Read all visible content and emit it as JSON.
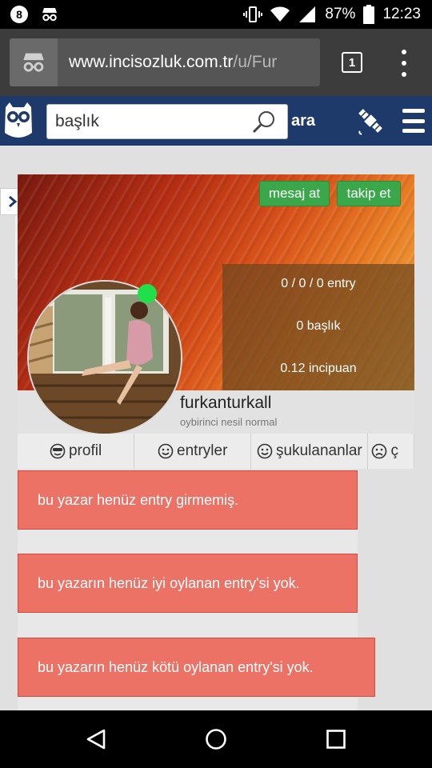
{
  "status_bar": {
    "battery": "87%",
    "time": "12:23"
  },
  "browser": {
    "url_main": "www.incisozluk.com.tr",
    "url_path": "/u/Fur",
    "tab_count": "1"
  },
  "site_nav": {
    "search_placeholder": "başlık",
    "search_button": "ara"
  },
  "profile": {
    "buttons": {
      "message": "mesaj at",
      "follow": "takip et"
    },
    "stats": {
      "entries": "0 / 0 / 0 entry",
      "topics": "0 başlık",
      "points": "0.12 incipuan"
    },
    "username": "furkanturkall",
    "user_title": "oybirinci nesil normal",
    "online": true
  },
  "tabs": [
    {
      "icon": "cool-face-icon",
      "label": "profil"
    },
    {
      "icon": "smile-icon",
      "label": "entryler"
    },
    {
      "icon": "smile-icon",
      "label": "şukulananlar"
    },
    {
      "icon": "sad-face-icon",
      "label": "ç"
    }
  ],
  "alerts": [
    "bu yazar henüz entry girmemiş.",
    "bu yazarın henüz iyi oylanan entry'si yok.",
    "bu yazarın henüz kötü oylanan entry'si yok."
  ],
  "colors": {
    "site_nav": "#1d3a6b",
    "alert": "#ed7266",
    "button_green": "#3aa84a",
    "online": "#1fe04a"
  }
}
